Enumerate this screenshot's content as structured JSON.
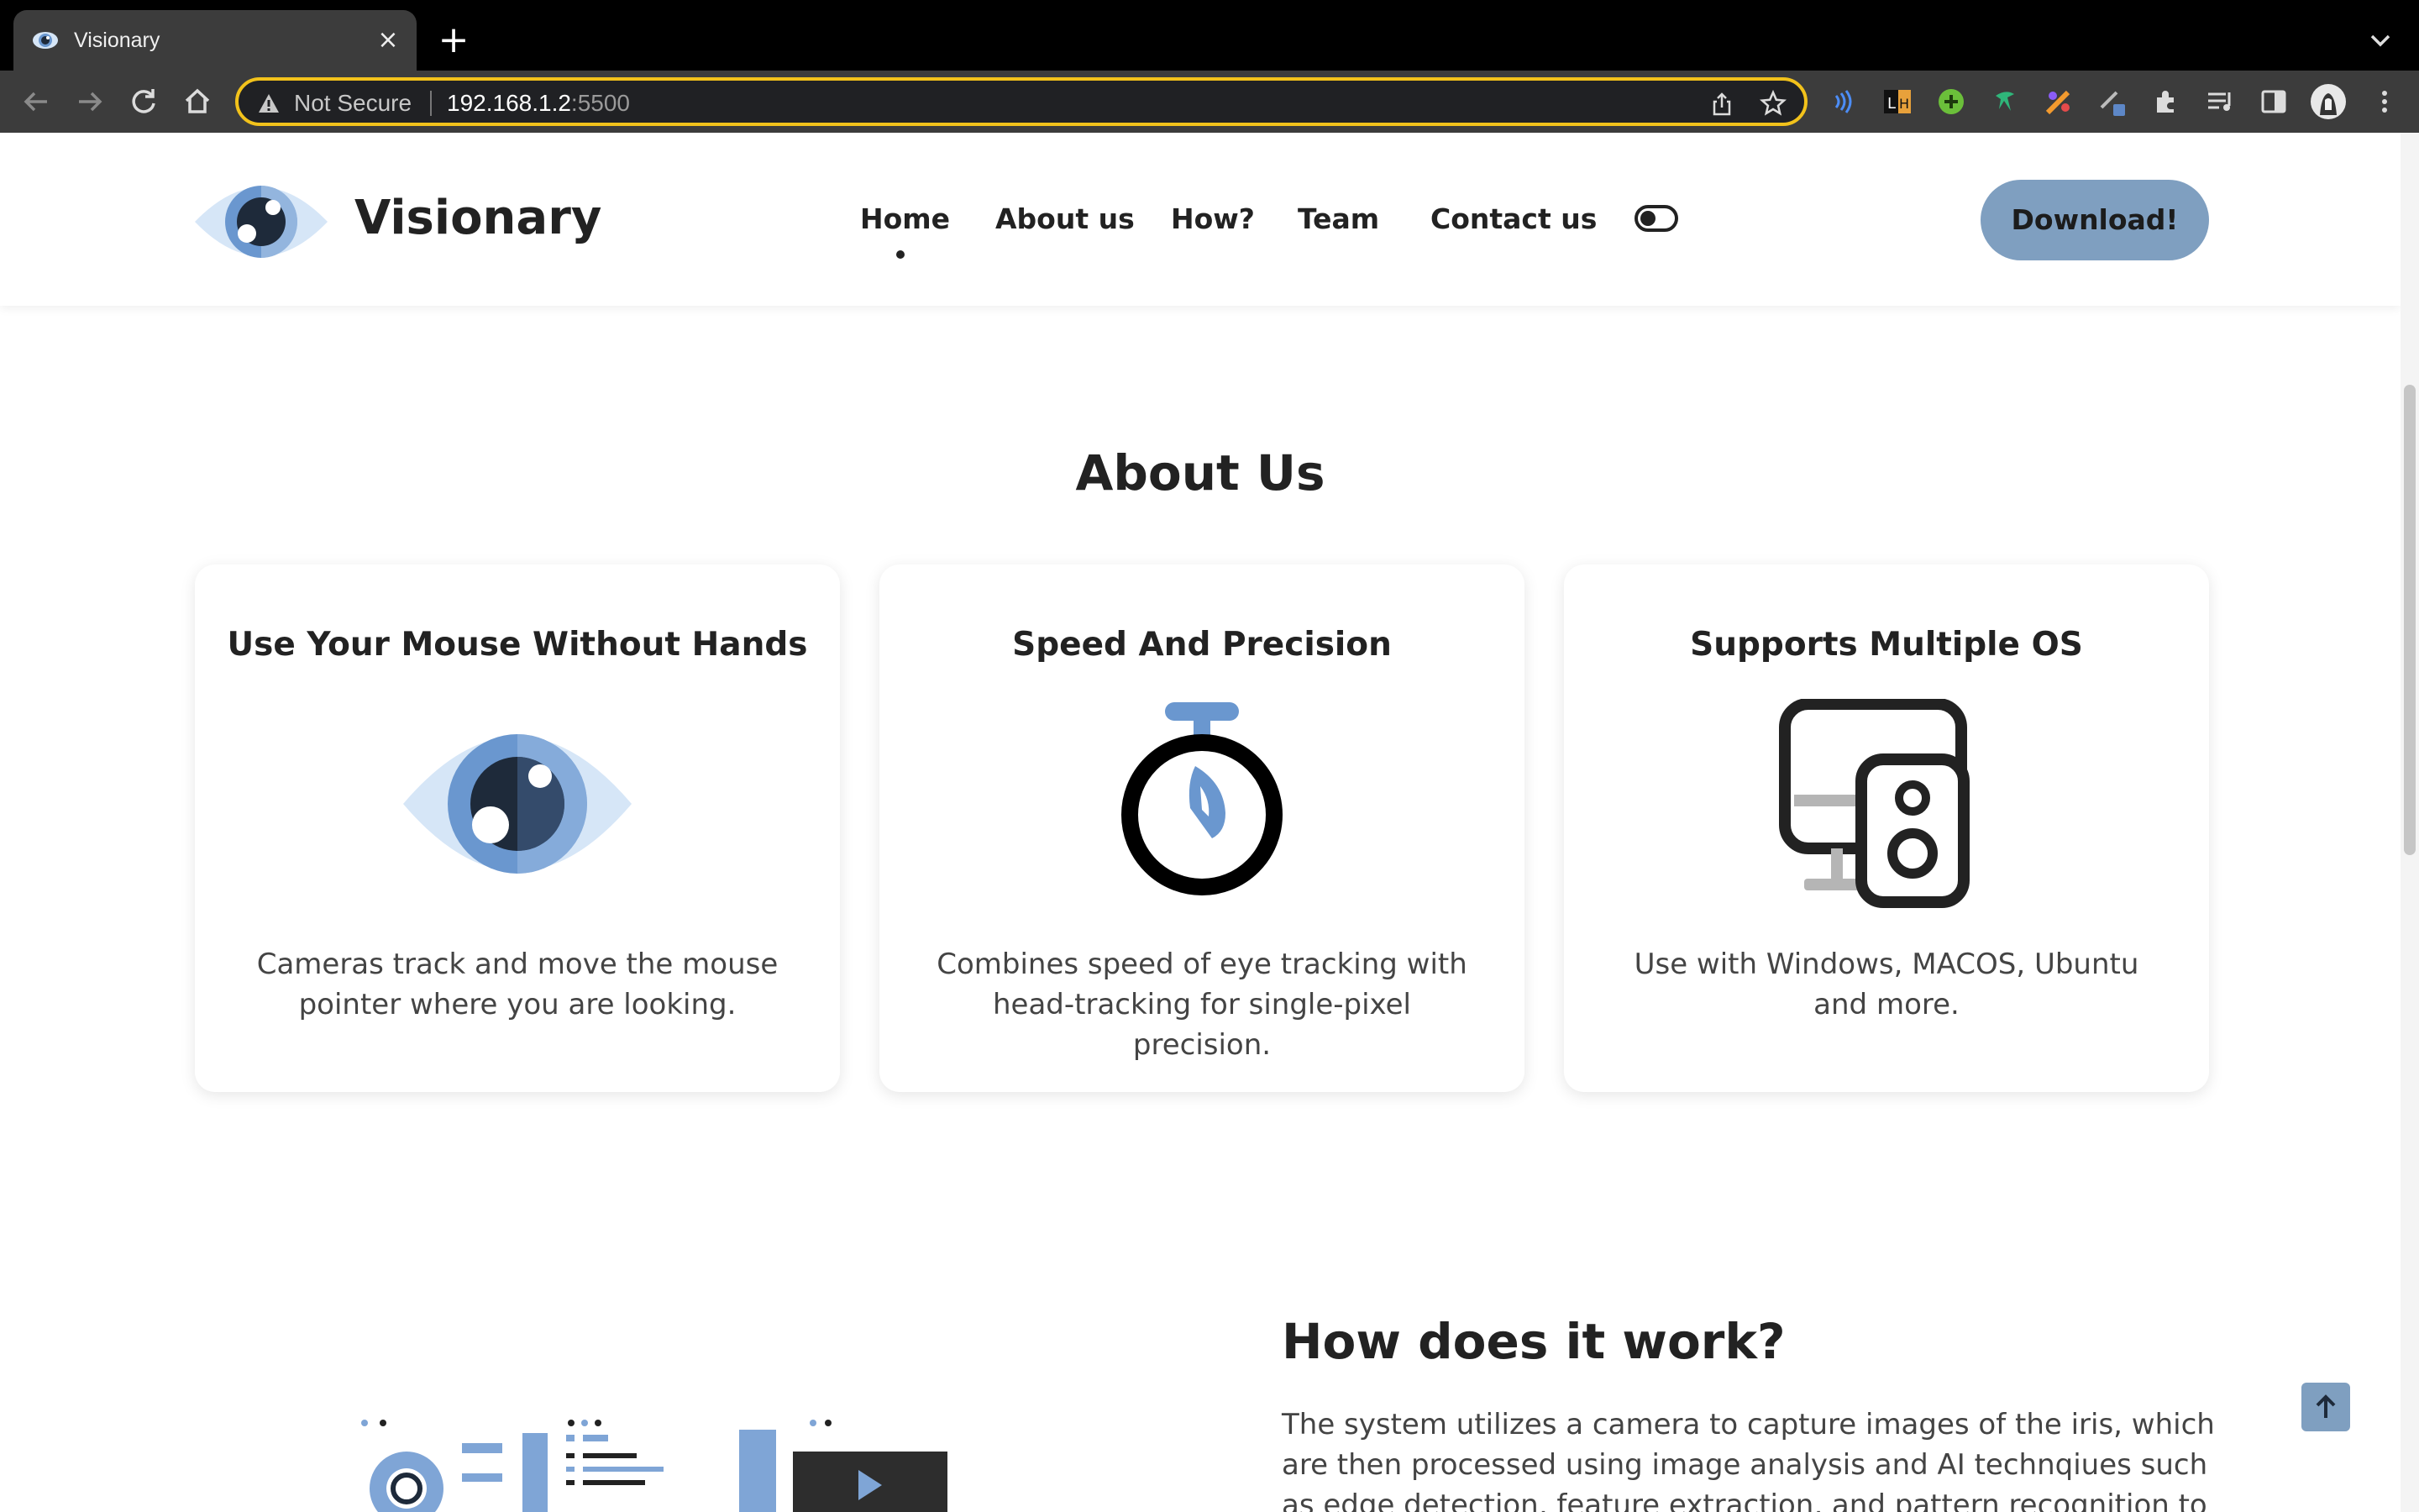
{
  "browser": {
    "tab_title": "Visionary",
    "tab_close": "×",
    "new_tab": "+",
    "not_secure": "Not Secure",
    "url_host": "192.168.1.2",
    "url_port": ":5500"
  },
  "header": {
    "logo_text": "Visionary",
    "nav": [
      "Home",
      "About us",
      "How?",
      "Team",
      "Contact us"
    ],
    "active_nav": "Home",
    "download_label": "Download!"
  },
  "about": {
    "title": "About Us",
    "cards": [
      {
        "title": "Use Your Mouse Without Hands",
        "icon": "eye-icon",
        "description": "Cameras track and move the mouse pointer where you are looking."
      },
      {
        "title": "Speed And Precision",
        "icon": "stopwatch-icon",
        "description": "Combines speed of eye tracking with head-tracking for single-pixel precision."
      },
      {
        "title": "Supports Multiple OS",
        "icon": "devices-icon",
        "description": "Use with Windows, MACOS, Ubuntu and more."
      }
    ]
  },
  "how": {
    "title": "How does it work?",
    "text": "The system utilizes a camera to capture images of the iris, which are then processed using image analysis and AI technqiues such as edge detection, feature extraction, and pattern recognition to track"
  },
  "colors": {
    "accent": "#7f9fc0",
    "eye_light": "#d6e6f7",
    "eye_mid": "#6a97cf",
    "eye_dark": "#1e2a3a",
    "omnibox_border": "#f2c21b"
  }
}
